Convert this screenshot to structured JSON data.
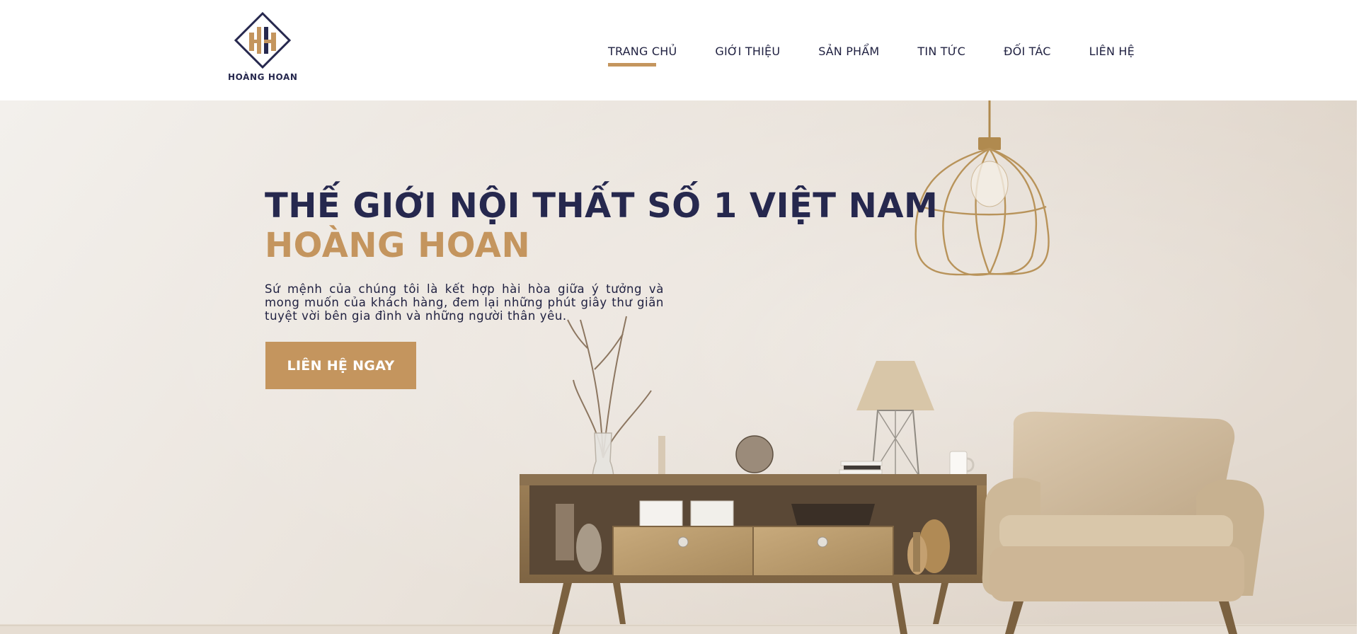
{
  "brand": {
    "logo_text": "HOÀNG HOAN",
    "colors": {
      "navy": "#26284e",
      "gold": "#c4955e"
    }
  },
  "nav": {
    "items": [
      {
        "label": "TRANG CHỦ",
        "active": true
      },
      {
        "label": "GIỚI THIỆU",
        "active": false
      },
      {
        "label": "SẢN PHẨM",
        "active": false
      },
      {
        "label": "TIN TỨC",
        "active": false
      },
      {
        "label": "ĐỐI TÁC",
        "active": false
      },
      {
        "label": "LIÊN HỆ",
        "active": false
      }
    ]
  },
  "hero": {
    "title": "THẾ GIỚI NỘI THẤT SỐ 1 VIỆT NAM",
    "subtitle": "HOÀNG HOAN",
    "description": "Sứ mệnh của chúng tôi là kết hợp hài hòa giữa ý tưởng và mong muốn của khách hàng, đem lại những phút giây thư giãn tuyệt vời bên gia đình và những người thân yêu.",
    "cta_label": "LIÊN HỆ NGAY",
    "image_subject": "living-room-interior-photo"
  }
}
